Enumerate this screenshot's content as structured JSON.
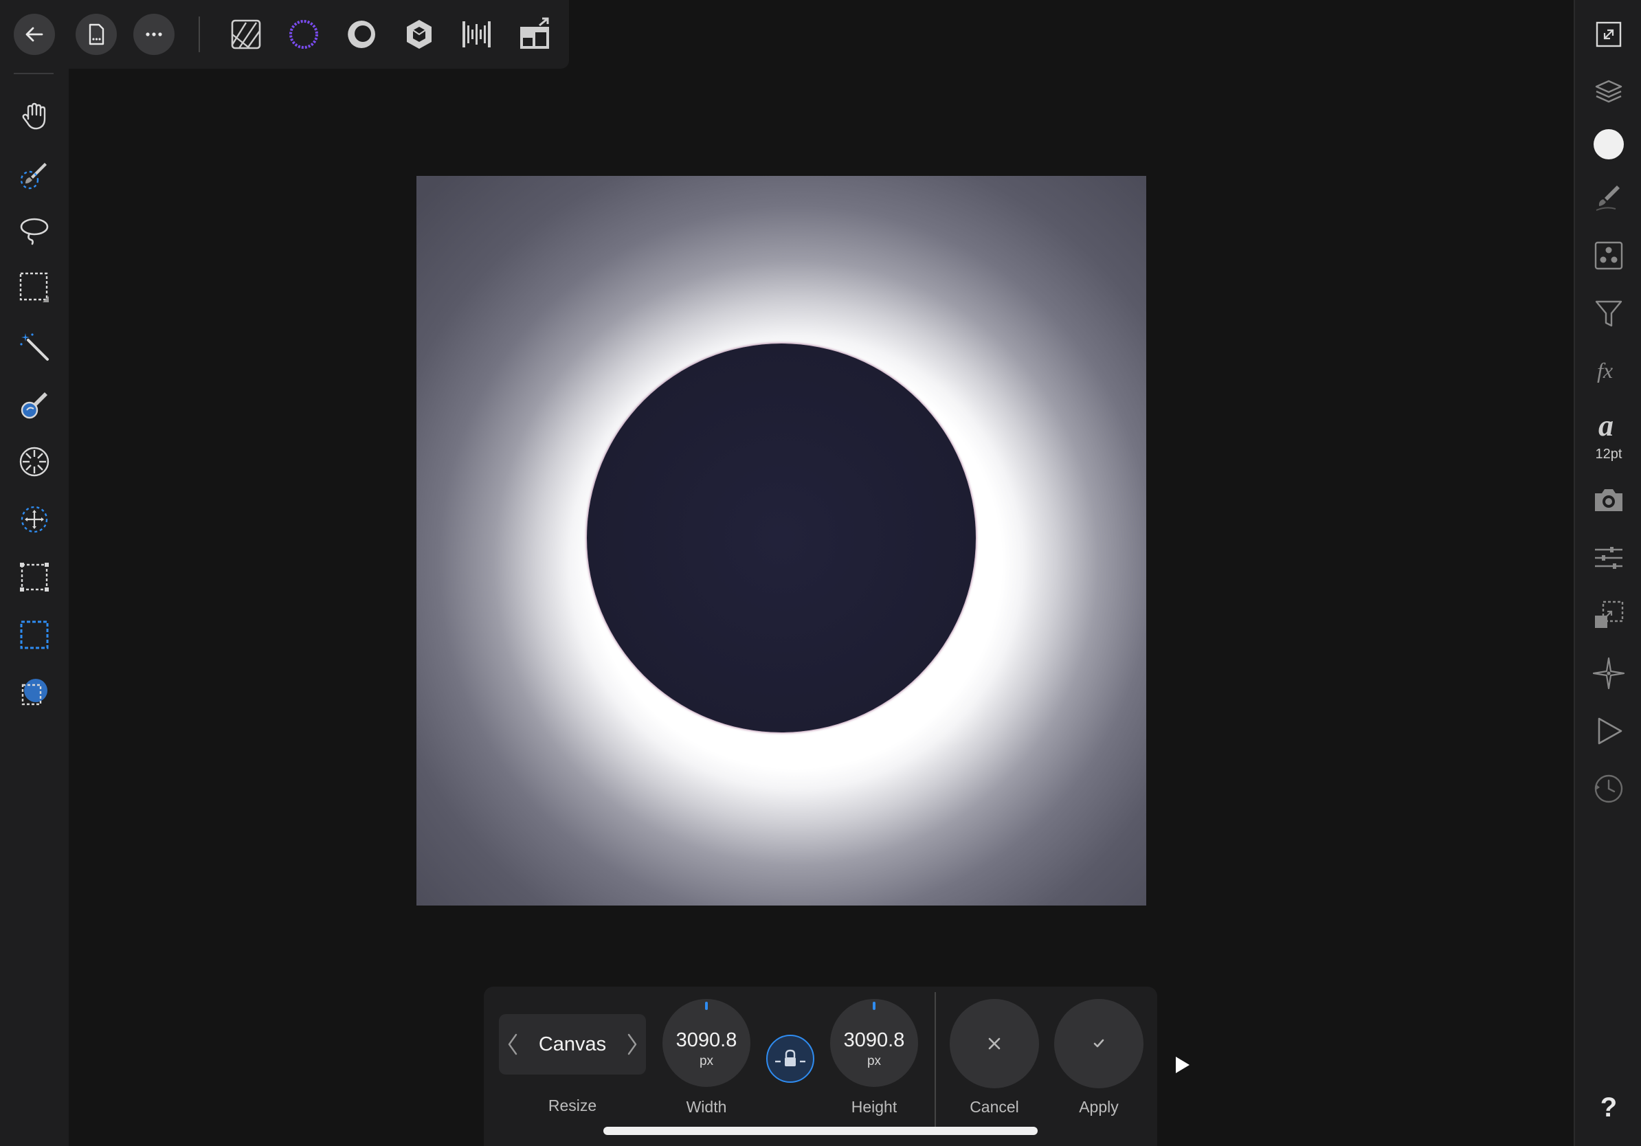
{
  "context_toolbar": {
    "persona_switch_label": "Canvas",
    "resize_caption": "Resize",
    "width": {
      "value": "3090.8",
      "unit": "px",
      "caption": "Width"
    },
    "height": {
      "value": "3090.8",
      "unit": "px",
      "caption": "Height"
    },
    "cancel_caption": "Cancel",
    "apply_caption": "Apply"
  },
  "studio": {
    "font_size_label": "12pt",
    "help_label": "?"
  },
  "colors": {
    "accent_blue": "#2f8cf0",
    "persona_purple": "#7a4cf0",
    "panel_bg": "#1e1e1f",
    "workspace_bg": "#141414"
  },
  "icons": {
    "top_bar": [
      "back-arrow-icon",
      "document-icon",
      "more-icon",
      "photo-persona-icon",
      "liquify-persona-icon",
      "develop-persona-icon",
      "tone-mapping-persona-icon",
      "export-persona-icon",
      "layout-persona-icon"
    ],
    "left_tools": [
      "hand-icon",
      "brush-selection-icon",
      "lasso-icon",
      "marquee-icon",
      "magic-wand-icon",
      "selection-brush-icon",
      "radial-icon",
      "transform-selection-icon",
      "crop-frame-icon",
      "dashed-rect-icon",
      "vector-crop-icon"
    ],
    "right_studio": [
      "fullscreen-icon",
      "layers-icon",
      "color-swatch-icon",
      "brushes-icon",
      "channels-icon",
      "filter-icon",
      "fx-icon",
      "text-style-icon",
      "camera-icon",
      "adjustments-icon",
      "transform-icon",
      "navigator-icon",
      "play-icon",
      "history-icon",
      "help-icon"
    ]
  }
}
